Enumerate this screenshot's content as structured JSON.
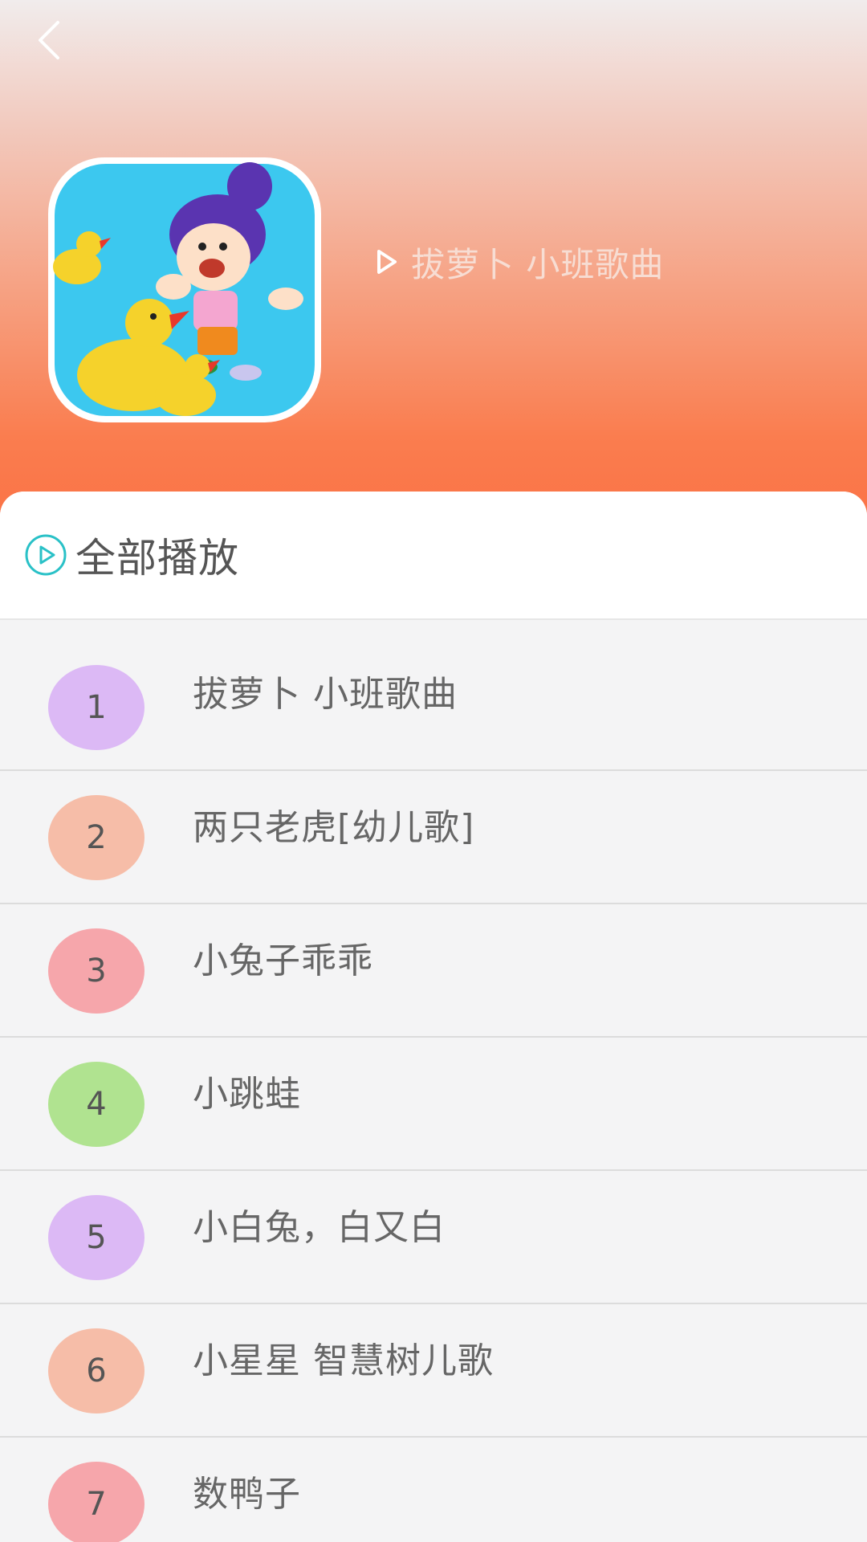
{
  "header": {
    "title": "拔萝卜 小班歌曲"
  },
  "play_all": {
    "label": "全部播放"
  },
  "songs": [
    {
      "num": "1",
      "title": "拔萝卜 小班歌曲",
      "color": "#dcb9f5"
    },
    {
      "num": "2",
      "title": "两只老虎[幼儿歌]",
      "color": "#f6bda8"
    },
    {
      "num": "3",
      "title": "小兔子乖乖",
      "color": "#f6a6ab"
    },
    {
      "num": "4",
      "title": "小跳蛙",
      "color": "#b0e390"
    },
    {
      "num": "5",
      "title": "小白兔，白又白",
      "color": "#dcb9f5"
    },
    {
      "num": "6",
      "title": "小星星 智慧树儿歌",
      "color": "#f6bda8"
    },
    {
      "num": "7",
      "title": "数鸭子",
      "color": "#f6a6ab"
    }
  ],
  "colors": {
    "accent": "#2ac1c7",
    "header_bottom": "#fb7447"
  }
}
